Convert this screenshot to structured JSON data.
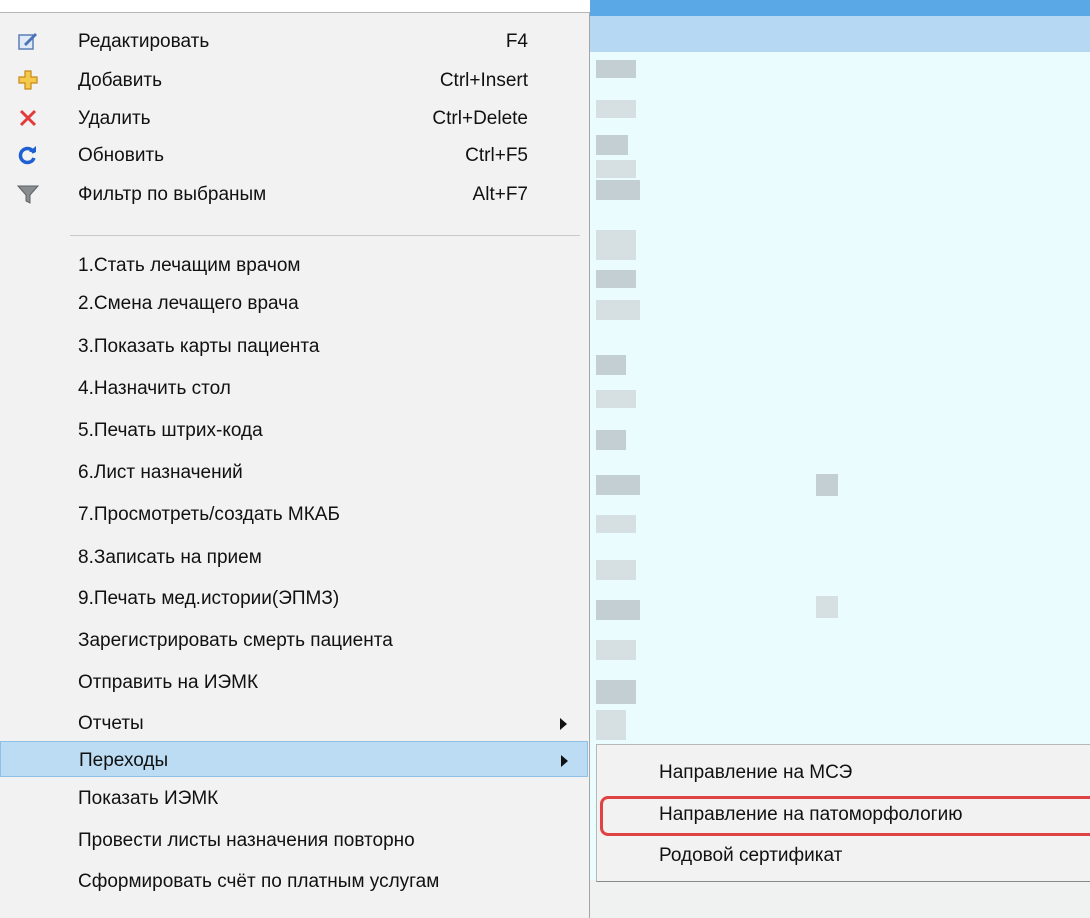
{
  "menu": {
    "items": [
      {
        "label": "Редактировать",
        "shortcut": "F4",
        "icon": "edit-icon"
      },
      {
        "label": "Добавить",
        "shortcut": "Ctrl+Insert",
        "icon": "add-icon"
      },
      {
        "label": "Удалить",
        "shortcut": "Ctrl+Delete",
        "icon": "delete-icon"
      },
      {
        "label": "Обновить",
        "shortcut": "Ctrl+F5",
        "icon": "refresh-icon"
      },
      {
        "label": "Фильтр по выбраным",
        "shortcut": "Alt+F7",
        "icon": "filter-icon"
      },
      {
        "label": "1.Стать лечащим врачом"
      },
      {
        "label": "2.Смена лечащего врача"
      },
      {
        "label": "3.Показать карты пациента"
      },
      {
        "label": "4.Назначить стол"
      },
      {
        "label": "5.Печать штрих-кода"
      },
      {
        "label": "6.Лист назначений"
      },
      {
        "label": "7.Просмотреть/создать МКАБ"
      },
      {
        "label": "8.Записать на прием"
      },
      {
        "label": "9.Печать мед.истории(ЭПМЗ)"
      },
      {
        "label": "Зарегистрировать смерть пациента"
      },
      {
        "label": "Отправить на ИЭМК"
      },
      {
        "label": "Отчеты",
        "submenu": true
      },
      {
        "label": "Переходы",
        "submenu": true,
        "highlighted": true
      },
      {
        "label": "Показать ИЭМК"
      },
      {
        "label": "Провести листы назначения повторно"
      },
      {
        "label": "Сформировать счёт по платным услугам"
      }
    ]
  },
  "submenu": {
    "items": [
      {
        "label": "Направление на МСЭ"
      },
      {
        "label": "Направление на патоморфологию",
        "annotated": true
      },
      {
        "label": "Родовой сертификат"
      }
    ]
  },
  "colors": {
    "menu_bg": "#f2f2f2",
    "highlight_bg": "#bcdcf4",
    "annotation_border": "#e04343",
    "grid_header": "#5aa8e6"
  }
}
